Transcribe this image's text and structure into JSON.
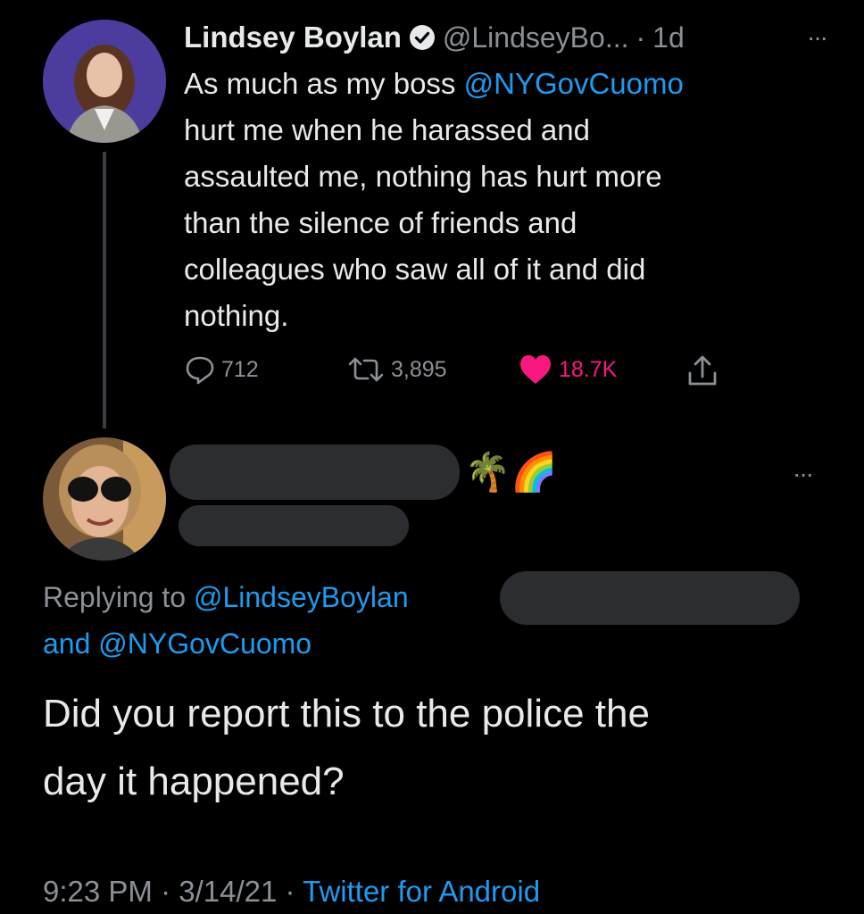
{
  "tweet": {
    "author_name": "Lindsey Boylan",
    "handle": "@LindseyBo...",
    "sep": "·",
    "age": "1d",
    "more": "···",
    "text_pre": "As much as my boss ",
    "mention": "@NYGovCuomo",
    "text_post": "hurt me when he harassed and assaulted me, nothing has hurt more than the silence of friends and colleagues who saw all of it and did nothing.",
    "lines": [
      "hurt me when he harassed and",
      "assaulted me, nothing has hurt more",
      "than the silence of friends and",
      "colleagues who saw all of it and did",
      "nothing."
    ],
    "replies": "712",
    "retweets": "3,895",
    "likes": "18.7K",
    "like_color": "#f91880"
  },
  "reply": {
    "emoji_1": "🌴",
    "emoji_2": "🌈",
    "more": "···",
    "replying_label": "Replying to ",
    "replying_to_1": "@LindseyBoylan",
    "and_label": "and ",
    "replying_to_2": "@NYGovCuomo",
    "text_line1": "Did you report this to the police the",
    "text_line2": "day it happened?",
    "time": "9:23 PM",
    "sep": "·",
    "date": "3/14/21",
    "source": "Twitter for Android"
  },
  "colors": {
    "accent": "#1d9bf0",
    "background": "#000000",
    "muted": "#8b9096"
  }
}
